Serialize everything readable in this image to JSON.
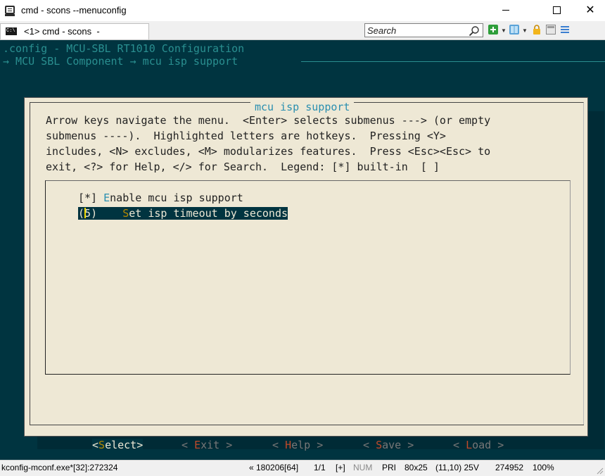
{
  "window": {
    "title": "cmd - scons  --menuconfig",
    "controls": {
      "minimize": "minimize",
      "maximize": "maximize",
      "close": "✕"
    }
  },
  "tabbar": {
    "tab_label": "<1> cmd - scons  -",
    "tab_icon_text": "C:\\",
    "search_placeholder": "Search"
  },
  "terminal": {
    "config_line": ".config - MCU-SBL RT1010 Configuration",
    "breadcrumb": "→ MCU SBL Component → mcu isp support ",
    "dialog": {
      "title": "mcu isp support",
      "help_lines": [
        "Arrow keys navigate the menu.  <Enter> selects submenus ---> (or empty",
        "submenus ----).  Highlighted letters are hotkeys.  Pressing <Y>",
        "includes, <N> excludes, <M> modularizes features.  Press <Esc><Esc> to",
        "exit, <?> for Help, </> for Search.  Legend: [*] built-in  [ ]"
      ],
      "menu_items": [
        {
          "prefix": "[*] ",
          "hotkey": "E",
          "rest": "nable mcu isp support",
          "selected": false
        },
        {
          "prefix": "(",
          "value": "5",
          "close": ")    ",
          "hotkey": "S",
          "rest": "et isp timeout by seconds",
          "selected": true
        }
      ],
      "buttons": [
        {
          "open": "<",
          "hotkey": "S",
          "rest": "elect",
          "close": ">",
          "selected": true
        },
        {
          "open": "< ",
          "hotkey": "E",
          "rest": "xit",
          "close": " >",
          "selected": false
        },
        {
          "open": "< ",
          "hotkey": "H",
          "rest": "elp",
          "close": " >",
          "selected": false
        },
        {
          "open": "< ",
          "hotkey": "S",
          "rest": "ave",
          "close": " >",
          "selected": false
        },
        {
          "open": "< ",
          "hotkey": "L",
          "rest": "oad",
          "close": " >",
          "selected": false
        }
      ]
    }
  },
  "statusbar": {
    "process": "kconfig-mconf.exe*[32]:272324",
    "build": "« 180206[64]",
    "position": "1/1",
    "plus": "[+]",
    "num": "NUM",
    "pri": "PRI",
    "size": "80x25",
    "cursor": "(11,10) 25V",
    "pid": "274952",
    "zoom": "100%"
  },
  "colors": {
    "terminal_bg": "#003440",
    "dialog_bg": "#eee8d5",
    "accent_cyan": "#2a8f90",
    "hotkey_yellow": "#b58900",
    "hotkey_red": "#c04a2a"
  }
}
